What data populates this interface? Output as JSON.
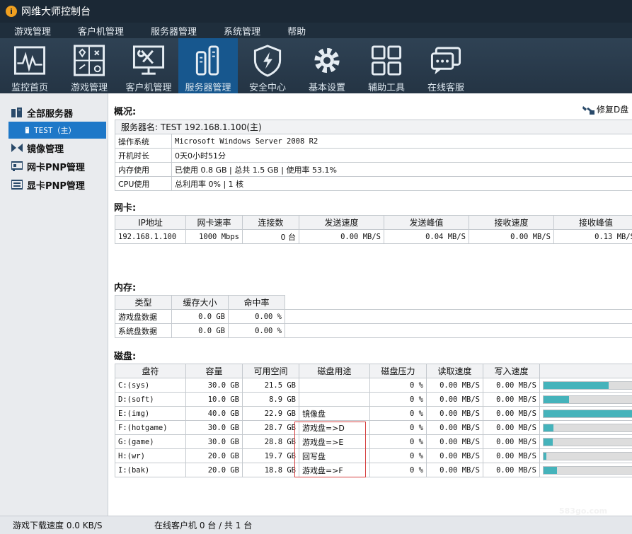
{
  "window": {
    "title": "网维大师控制台"
  },
  "menu": [
    "游戏管理",
    "客户机管理",
    "服务器管理",
    "系统管理",
    "帮助"
  ],
  "toolbar": [
    {
      "label": "监控首页",
      "icon": "monitor-icon"
    },
    {
      "label": "游戏管理",
      "icon": "game-icon"
    },
    {
      "label": "客户机管理",
      "icon": "client-tools-icon"
    },
    {
      "label": "服务器管理",
      "icon": "server-icon",
      "active": true
    },
    {
      "label": "安全中心",
      "icon": "shield-icon"
    },
    {
      "label": "基本设置",
      "icon": "gear-icon"
    },
    {
      "label": "辅助工具",
      "icon": "grid-icon"
    },
    {
      "label": "在线客服",
      "icon": "chat-icon"
    }
  ],
  "sidebar": {
    "all_servers": "全部服务器",
    "server": "TEST（主）",
    "image": "镜像管理",
    "nic_pnp": "网卡PNP管理",
    "gpu_pnp": "显卡PNP管理"
  },
  "overview": {
    "title": "概况:",
    "repair": "修复D盘",
    "server_name": "服务器名: TEST 192.168.1.100(主)",
    "rows": [
      {
        "k": "操作系统",
        "v": "Microsoft Windows Server 2008 R2"
      },
      {
        "k": "开机时长",
        "v": "0天0小时51分"
      },
      {
        "k": "内存使用",
        "v": "已使用 0.8 GB | 总共 1.5 GB | 使用率 53.1%"
      },
      {
        "k": "CPU使用",
        "v": "总利用率 0% | 1 核"
      }
    ]
  },
  "nic": {
    "title": "网卡:",
    "headers": [
      "IP地址",
      "网卡速率",
      "连接数",
      "发送速度",
      "发送峰值",
      "接收速度",
      "接收峰值"
    ],
    "row": [
      "192.168.1.100",
      "1000 Mbps",
      "0 台",
      "0.00 MB/S",
      "0.04 MB/S",
      "0.00 MB/S",
      "0.13 MB/S"
    ]
  },
  "memory": {
    "title": "内存:",
    "headers": [
      "类型",
      "缓存大小",
      "命中率"
    ],
    "rows": [
      [
        "游戏盘数据",
        "0.0 GB",
        "0.00 %"
      ],
      [
        "系统盘数据",
        "0.0 GB",
        "0.00 %"
      ]
    ]
  },
  "disk": {
    "title": "磁盘:",
    "headers": [
      "盘符",
      "容量",
      "可用空间",
      "磁盘用途",
      "磁盘压力",
      "读取速度",
      "写入速度"
    ],
    "rows": [
      {
        "cells": [
          "C:(sys)",
          "30.0 GB",
          "21.5 GB",
          "",
          "0 %",
          "0.00 MB/S",
          "0.00 MB/S"
        ],
        "usage": 0.72
      },
      {
        "cells": [
          "D:(soft)",
          "10.0 GB",
          "8.9 GB",
          "",
          "0 %",
          "0.00 MB/S",
          "0.00 MB/S"
        ],
        "usage": 0.28
      },
      {
        "cells": [
          "E:(img)",
          "40.0 GB",
          "22.9 GB",
          "镜像盘",
          "0 %",
          "0.00 MB/S",
          "0.00 MB/S"
        ],
        "usage": 1.0
      },
      {
        "cells": [
          "F:(hotgame)",
          "30.0 GB",
          "28.7 GB",
          "游戏盘=>D",
          "0 %",
          "0.00 MB/S",
          "0.00 MB/S"
        ],
        "usage": 0.11
      },
      {
        "cells": [
          "G:(game)",
          "30.0 GB",
          "28.8 GB",
          "游戏盘=>E",
          "0 %",
          "0.00 MB/S",
          "0.00 MB/S"
        ],
        "usage": 0.1
      },
      {
        "cells": [
          "H:(wr)",
          "20.0 GB",
          "19.7 GB",
          "回写盘",
          "0 %",
          "0.00 MB/S",
          "0.00 MB/S"
        ],
        "usage": 0.03
      },
      {
        "cells": [
          "I:(bak)",
          "20.0 GB",
          "18.8 GB",
          "游戏盘=>F",
          "0 %",
          "0.00 MB/S",
          "0.00 MB/S"
        ],
        "usage": 0.15
      }
    ]
  },
  "status": {
    "download": "游戏下载速度 0.0 KB/S",
    "online": "在线客户机 0 台 / 共 1 台"
  },
  "watermark": "583go.com",
  "colors": {
    "accent": "#1e78c8",
    "bar": "#45b3bb",
    "highlight": "#d64040"
  }
}
